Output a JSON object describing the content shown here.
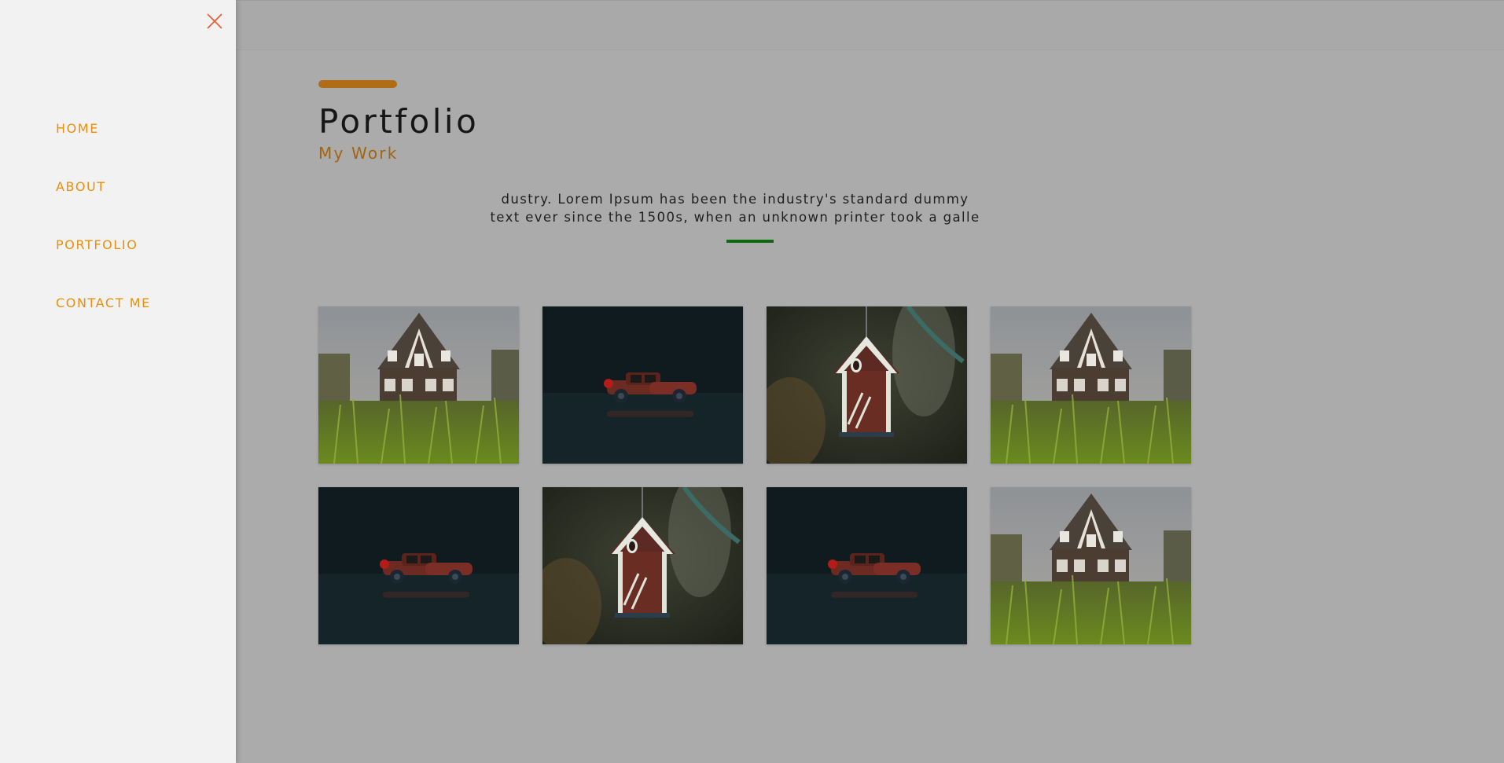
{
  "drawer": {
    "close_label": "close",
    "nav": [
      {
        "label": "HOME"
      },
      {
        "label": "ABOUT"
      },
      {
        "label": "PORTFOLIO"
      },
      {
        "label": "CONTACT ME"
      }
    ]
  },
  "section": {
    "title": "Portfolio",
    "subtitle": "My Work",
    "description_line1": "dustry. Lorem Ipsum has been the industry's standard dummy",
    "description_line2": "text ever since the 1500s, when an unknown printer took a galle"
  },
  "gallery": {
    "items": [
      {
        "image": "house-in-grass-photo"
      },
      {
        "image": "toy-car-photo"
      },
      {
        "image": "birdhouse-photo"
      },
      {
        "image": "house-in-grass-photo"
      },
      {
        "image": "toy-car-photo"
      },
      {
        "image": "birdhouse-photo"
      },
      {
        "image": "toy-car-photo"
      },
      {
        "image": "house-in-grass-photo"
      }
    ]
  },
  "colors": {
    "nav_link": "#e8900e",
    "accent_bar": "#b06d16",
    "subtitle": "#a4640f",
    "divider": "#0d6b0d",
    "close_icon": "#e8603a",
    "overlay": "#ababab",
    "drawer_bg": "#f2f2f2"
  }
}
